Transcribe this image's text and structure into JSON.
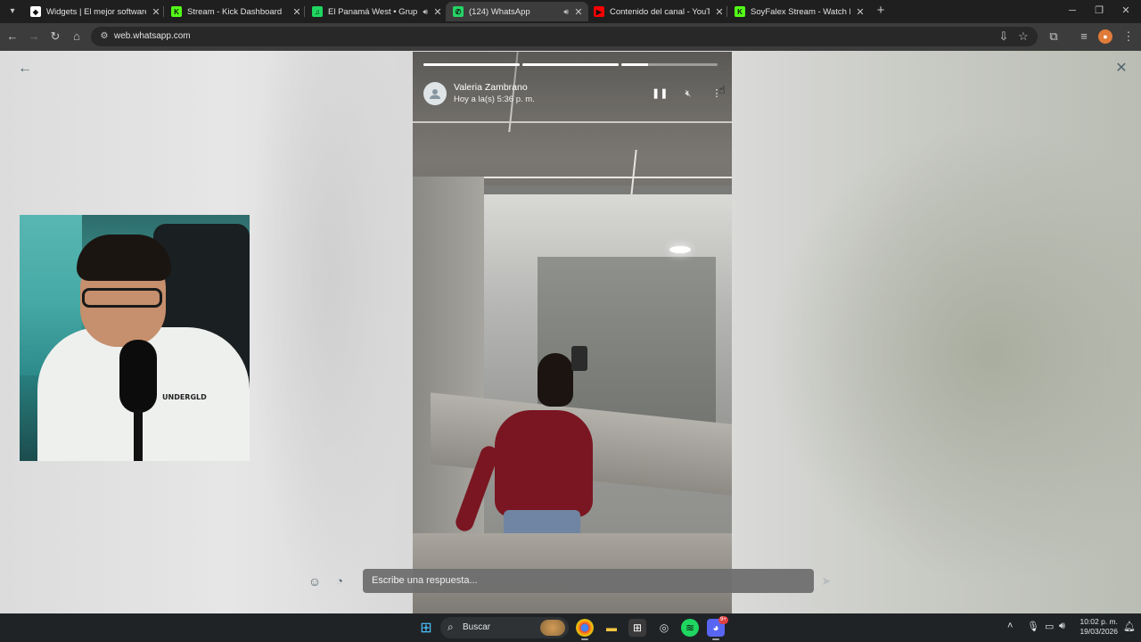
{
  "browser": {
    "tabs": [
      {
        "title": "Widgets | El mejor software pa",
        "favicon_color": "#ffffff",
        "favicon_glyph": "◆",
        "audio": false,
        "active": false
      },
      {
        "title": "Stream - Kick Dashboard",
        "favicon_color": "#53fc18",
        "favicon_glyph": "K",
        "audio": false,
        "active": false
      },
      {
        "title": "El Panamá West • Grupo La",
        "favicon_color": "#1ed760",
        "favicon_glyph": "♫",
        "audio": true,
        "active": false
      },
      {
        "title": "(124) WhatsApp",
        "favicon_color": "#25d366",
        "favicon_glyph": "✆",
        "audio": true,
        "active": true
      },
      {
        "title": "Contenido del canal - YouTube",
        "favicon_color": "#ff0000",
        "favicon_glyph": "▶",
        "audio": false,
        "active": false
      },
      {
        "title": "SoyFalex Stream - Watch Live o",
        "favicon_color": "#53fc18",
        "favicon_glyph": "K",
        "audio": false,
        "active": false
      }
    ],
    "url": "web.whatsapp.com"
  },
  "status_viewer": {
    "contact_name": "Valeria Zambrano",
    "timestamp": "Hoy a la(s) 5:36 p. m.",
    "segments_progress": [
      1,
      1,
      0.28
    ],
    "reply_placeholder": "Escribe una respuesta..."
  },
  "webcam": {
    "shirt_text": "UNDERGLD"
  },
  "taskbar": {
    "search_label": "Buscar",
    "discord_badge": "9+",
    "time": "10:02 p. m.",
    "date": "19/03/2026"
  },
  "icons": {
    "back": "arrow-left-icon",
    "close": "close-icon",
    "pause": "pause-icon",
    "mute": "muted-speaker-icon",
    "menu": "kebab-menu-icon",
    "emoji": "emoji-icon",
    "sticker": "sticker-icon",
    "send": "send-icon"
  },
  "colors": {
    "whatsapp_icon_gray": "#54656f",
    "taskbar_bg": "#202326",
    "browser_toolbar": "#3c3c3c"
  }
}
